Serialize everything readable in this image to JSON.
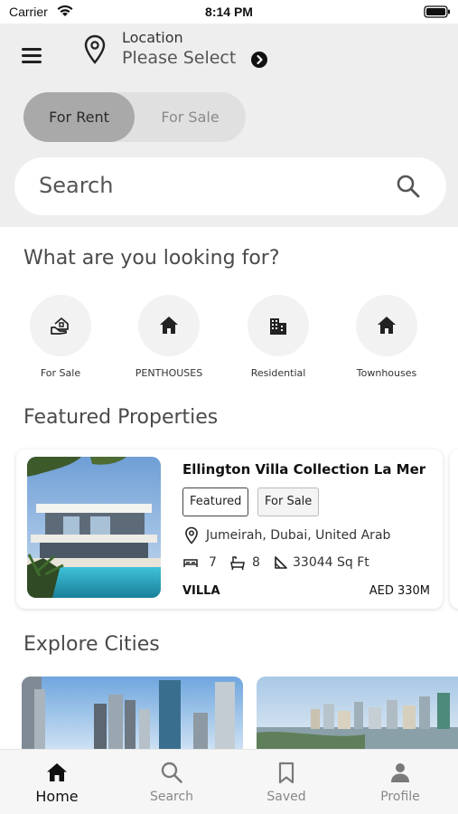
{
  "status": {
    "carrier": "Carrier",
    "time": "8:14 PM"
  },
  "header": {
    "location_label": "Location",
    "location_value": "Please Select",
    "toggle": {
      "rent": "For Rent",
      "sale": "For Sale",
      "selected": "For Rent"
    },
    "search_placeholder": "Search"
  },
  "categories": {
    "title": "What are you looking for?",
    "items": [
      {
        "label": "For Sale",
        "icon": "house-hand-icon"
      },
      {
        "label": "PENTHOUSES",
        "icon": "home-icon"
      },
      {
        "label": "Residential",
        "icon": "building-icon"
      },
      {
        "label": "Townhouses",
        "icon": "home-icon"
      }
    ]
  },
  "featured": {
    "title": "Featured Properties",
    "property": {
      "name": "Ellington Villa Collection La Mer",
      "tags": [
        "Featured",
        "For Sale"
      ],
      "location": "Jumeirah, Dubai, United Arab",
      "beds": "7",
      "baths": "8",
      "area": "33044 Sq Ft",
      "type": "VILLA",
      "price": "AED 330M"
    }
  },
  "cities": {
    "title": "Explore Cities"
  },
  "tabbar": {
    "items": [
      {
        "label": "Home",
        "icon": "home-icon"
      },
      {
        "label": "Search",
        "icon": "search-icon"
      },
      {
        "label": "Saved",
        "icon": "bookmark-icon"
      },
      {
        "label": "Profile",
        "icon": "person-icon"
      }
    ],
    "active": "Home"
  }
}
